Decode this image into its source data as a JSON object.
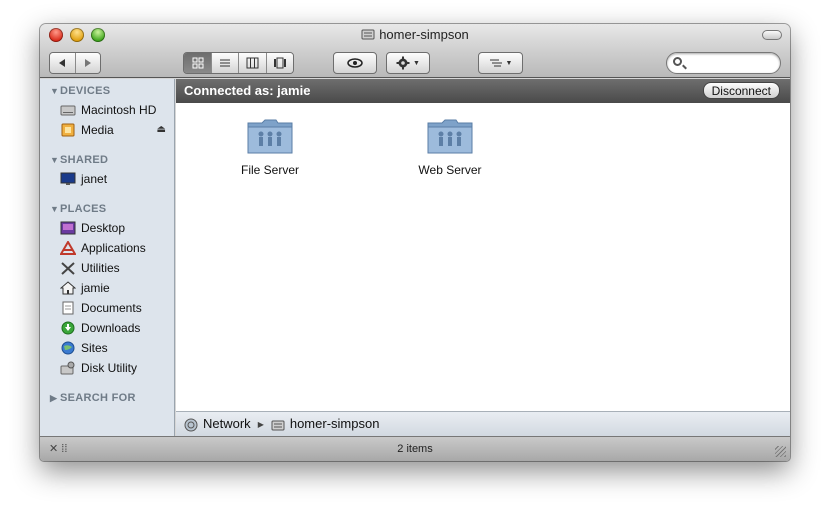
{
  "window": {
    "title": "homer-simpson"
  },
  "toolbar": {
    "back_icon": "back-arrow-icon",
    "forward_icon": "forward-arrow-icon",
    "view_modes": [
      "icon-view",
      "list-view",
      "column-view",
      "coverflow-view"
    ],
    "active_view": "icon-view",
    "search_placeholder": ""
  },
  "sidebar": {
    "sections": {
      "devices": "DEVICES",
      "shared": "SHARED",
      "places": "PLACES",
      "search_for": "SEARCH FOR"
    },
    "devices": [
      {
        "label": "Macintosh HD",
        "icon": "hard-drive-icon"
      },
      {
        "label": "Media",
        "icon": "external-drive-icon"
      }
    ],
    "shared": [
      {
        "label": "janet",
        "icon": "display-icon"
      }
    ],
    "places": [
      {
        "label": "Desktop",
        "icon": "desktop-icon"
      },
      {
        "label": "Applications",
        "icon": "applications-icon"
      },
      {
        "label": "Utilities",
        "icon": "utilities-icon"
      },
      {
        "label": "jamie",
        "icon": "home-icon"
      },
      {
        "label": "Documents",
        "icon": "documents-icon"
      },
      {
        "label": "Downloads",
        "icon": "downloads-icon"
      },
      {
        "label": "Sites",
        "icon": "sites-icon"
      },
      {
        "label": "Disk Utility",
        "icon": "disk-utility-icon"
      }
    ]
  },
  "main": {
    "connected_as": "Connected as: jamie",
    "disconnect_label": "Disconnect",
    "items": [
      {
        "label": "File Server",
        "icon": "shared-folder-icon"
      },
      {
        "label": "Web Server",
        "icon": "shared-folder-icon"
      }
    ]
  },
  "pathbar": {
    "segments": [
      "Network",
      "homer-simpson"
    ]
  },
  "status": {
    "item_count": "2 items"
  },
  "colors": {
    "sidebar_bg": "#dde4ec",
    "sidebar_header": "#6f7b87",
    "connected_bar": "#5a5a5a",
    "folder_blue": "#8fb0d4"
  }
}
